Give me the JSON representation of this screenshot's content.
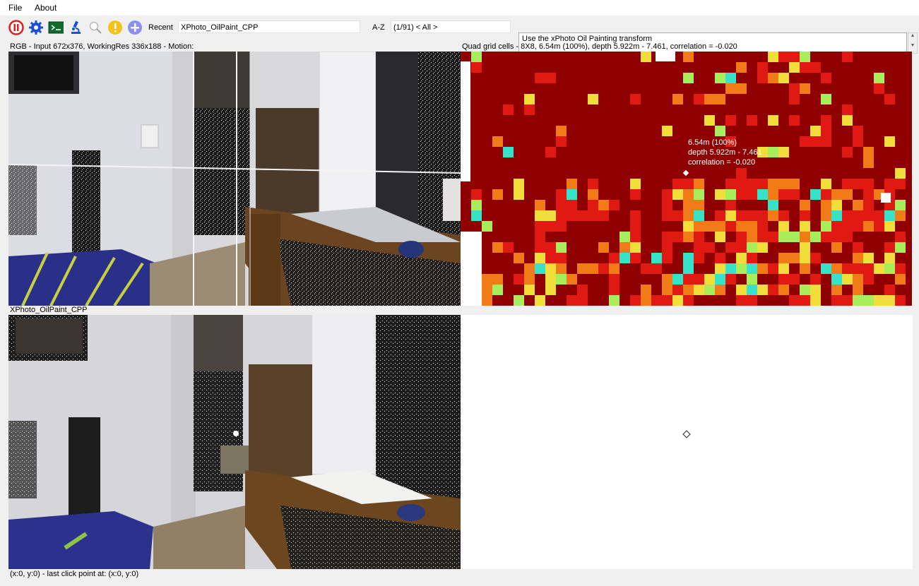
{
  "menu": {
    "file": "File",
    "about": "About"
  },
  "toolbar": {
    "icons": [
      "pause-icon",
      "settings-gear-icon",
      "terminal-icon",
      "microscope-icon",
      "magnifier-icon",
      "info-icon",
      "add-icon"
    ],
    "recent_label": "Recent",
    "recent_value": "XPhoto_OilPaint_CPP",
    "sort_label": "A-Z",
    "count_label": "(1/91) < All >",
    "description": "Use the xPhoto Oil Painting transform"
  },
  "panels": {
    "rgb_caption": "RGB - Input 672x376, WorkingRes 336x188 - Motion:",
    "quad_caption": "Quad grid cells - 8X8, 6.54m (100%), depth 5.922m - 7.461, correlation = -0.020",
    "quad_tooltip": {
      "line1": "6.54m (100%)",
      "line2": "depth 5.922m - 7.461",
      "line3": "correlation = -0.020"
    },
    "oil_caption": "XPhoto_OilPaint_CPP"
  },
  "status": "(x:0, y:0) - last click point at: (x:0, y:0)",
  "colors": {
    "heat_bg": "#8f0000",
    "heat_red": "#e01a12",
    "heat_orange": "#f27a17",
    "heat_yellow": "#f2de3b",
    "heat_lime": "#a8ee5a",
    "heat_cyan": "#36e3c8"
  }
}
